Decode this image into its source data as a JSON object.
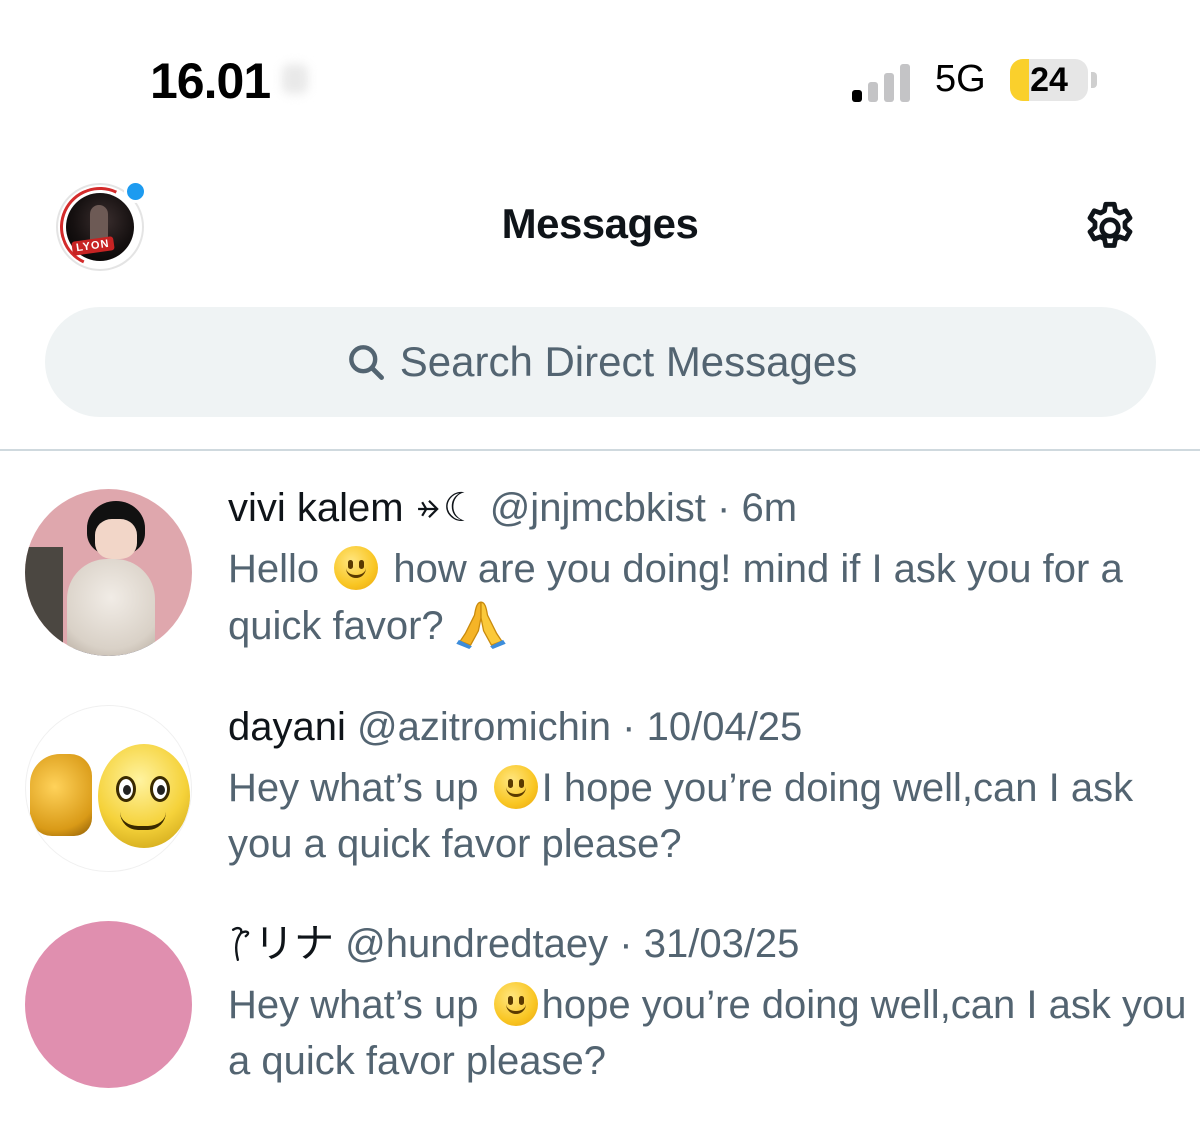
{
  "status_bar": {
    "time": "16.01",
    "network": "5G",
    "battery": "24",
    "battery_level_percent": 24,
    "signal_bars_active": 1,
    "signal_bars_total": 4
  },
  "header": {
    "title": "Messages",
    "profile_avatar_tag": "LYON",
    "settings_icon": "gear-icon",
    "accent_color": "#1d9bf0"
  },
  "search": {
    "placeholder": "Search Direct Messages",
    "icon": "search-icon"
  },
  "conversations": [
    {
      "name": "vivi kalem",
      "name_symbols": "☾",
      "handle": "@jnjmcbkist",
      "separator": "·",
      "time": "6m",
      "message_part1": "Hello",
      "message_part2": "how are you doing! mind if I ask you for a quick favor?",
      "avatar_color": "#dfa7ad"
    },
    {
      "name": "dayani",
      "handle": "@azitromichin",
      "separator": "·",
      "time": "10/04/25",
      "message_part1": "Hey what’s up",
      "message_part2": "I hope you’re doing well,can I ask you a quick favor please?",
      "avatar_color": "#ffffff"
    },
    {
      "name": "リナ",
      "handle": "@hundredtaey",
      "separator": "·",
      "time": "31/03/25",
      "message_part1": "Hey what’s up",
      "message_part2": "hope you’re doing well,can I ask you a quick favor please?",
      "avatar_color": "#e08faf"
    }
  ]
}
